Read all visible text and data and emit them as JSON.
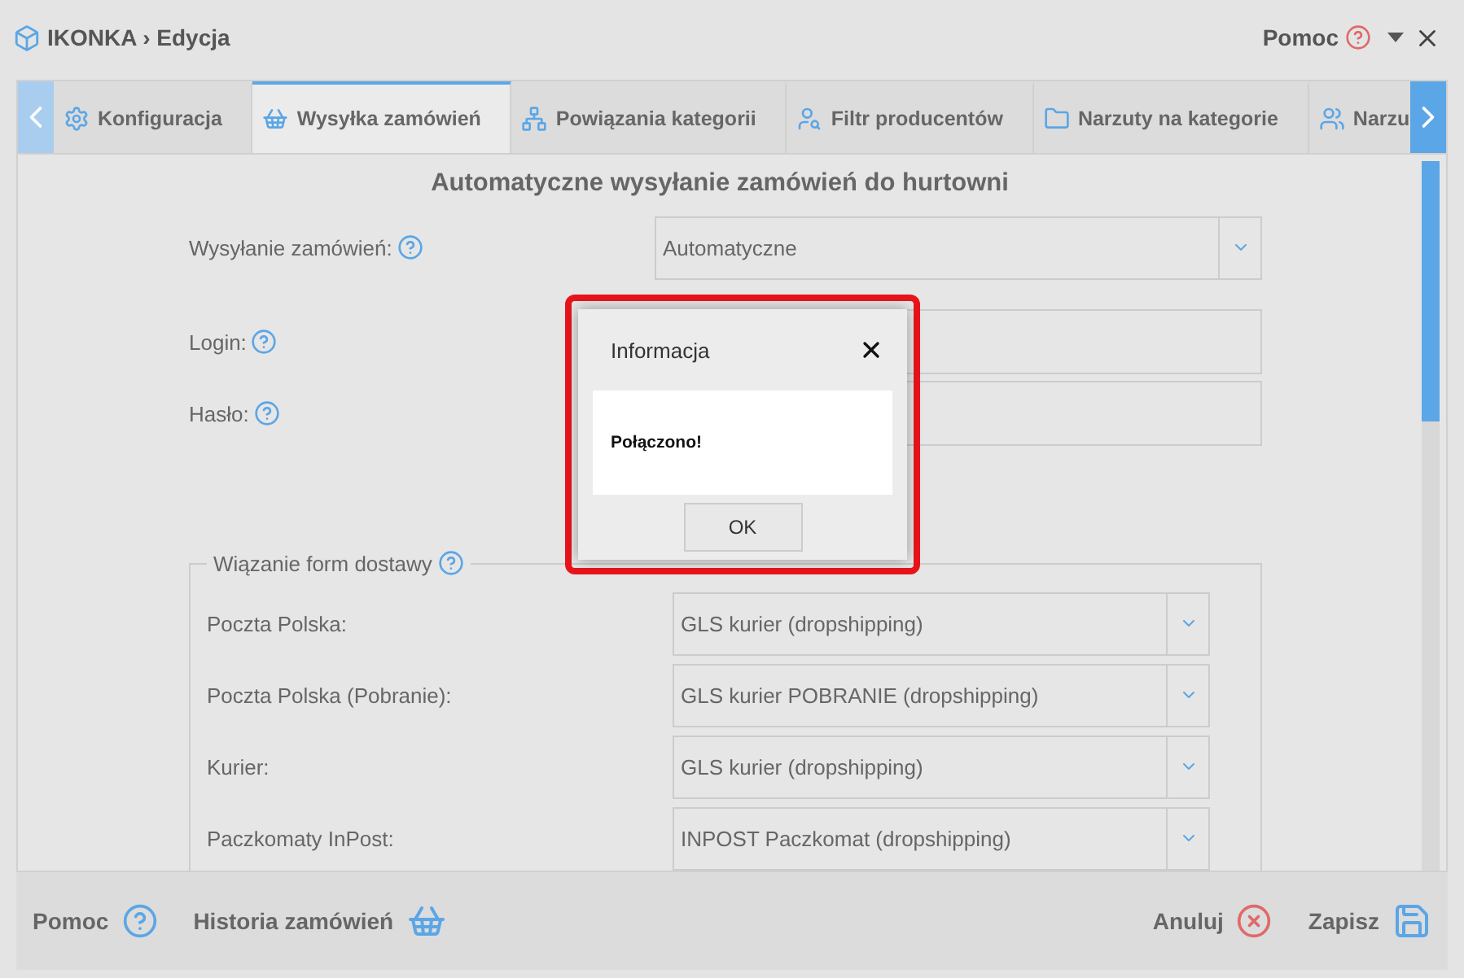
{
  "window": {
    "title": "IKONKA › Edycja",
    "help": "Pomoc"
  },
  "tabs": [
    {
      "label": "Konfiguracja",
      "selected": false
    },
    {
      "label": "Wysyłka zamówień",
      "selected": true
    },
    {
      "label": "Powiązania kategorii",
      "selected": false
    },
    {
      "label": "Filtr producentów",
      "selected": false
    },
    {
      "label": "Narzuty na kategorie",
      "selected": false
    },
    {
      "label": "Narzu",
      "selected": false
    }
  ],
  "heading": "Automatyczne wysyłanie zamówień do hurtowni",
  "fields": [
    {
      "label": "Wysyłanie zamówień:",
      "kind": "select",
      "value": "Automatyczne"
    },
    {
      "label": "Login:",
      "kind": "input"
    },
    {
      "label": "Hasło:",
      "kind": "input"
    }
  ],
  "shipping": {
    "legend": "Wiązanie form dostawy",
    "rows": [
      {
        "label": "Poczta Polska:",
        "value": "GLS kurier (dropshipping)"
      },
      {
        "label": "Poczta Polska (Pobranie):",
        "value": "GLS kurier POBRANIE (dropshipping)"
      },
      {
        "label": "Kurier:",
        "value": "GLS kurier (dropshipping)"
      },
      {
        "label": "Paczkomaty InPost:",
        "value": "INPOST Paczkomat (dropshipping)"
      }
    ]
  },
  "dialog": {
    "title": "Informacja",
    "message": "Połączono!",
    "button": "OK"
  },
  "footer": {
    "help": "Pomoc",
    "history": "Historia zamówień",
    "cancel": "Anuluj",
    "save": "Zapisz"
  }
}
